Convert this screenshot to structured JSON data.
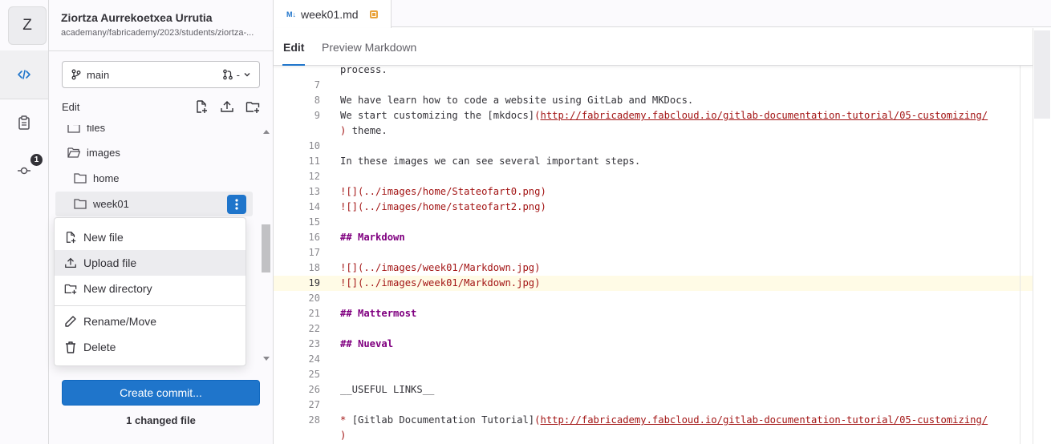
{
  "project": {
    "avatar_letter": "Z",
    "name": "Ziortza Aurrekoetxea Urrutia",
    "path": "academany/fabricademy/2023/students/ziortza-..."
  },
  "activity_bar": {
    "changes_badge": "1"
  },
  "branch": {
    "name": "main",
    "mr_label": "-"
  },
  "sidebar": {
    "edit_label": "Edit",
    "tree": [
      {
        "label": "files",
        "type": "folder"
      },
      {
        "label": "images",
        "type": "folder"
      },
      {
        "label": "home",
        "type": "folder"
      },
      {
        "label": "week01",
        "type": "folder",
        "selected": true
      }
    ],
    "context_menu": {
      "items": [
        "New file",
        "Upload file",
        "New directory",
        "Rename/Move",
        "Delete"
      ],
      "hovered": "Upload file"
    },
    "commit_button": "Create commit...",
    "changed_files": "1 changed file"
  },
  "editor": {
    "file_tab": "week01.md",
    "file_tab_icon": "M↓",
    "modes": {
      "edit": "Edit",
      "preview": "Preview Markdown"
    },
    "current_line": 19,
    "lines": [
      {
        "n": "",
        "segs": [
          {
            "t": "process."
          }
        ]
      },
      {
        "n": "7",
        "segs": []
      },
      {
        "n": "8",
        "segs": [
          {
            "t": "We have learn how to code a website using GitLab and MKDocs."
          }
        ]
      },
      {
        "n": "9",
        "segs": [
          {
            "t": "We start customizing the [mkdocs]"
          },
          {
            "t": "(",
            "c": "red"
          },
          {
            "t": "http://fabricademy.fabcloud.io/gitlab-documentation-tutorial/05-customizing/",
            "c": "url"
          }
        ]
      },
      {
        "n": "",
        "segs": [
          {
            "t": ")",
            "c": "red"
          },
          {
            "t": " theme."
          }
        ]
      },
      {
        "n": "10",
        "segs": []
      },
      {
        "n": "11",
        "segs": [
          {
            "t": "In these images we can see several important steps."
          }
        ]
      },
      {
        "n": "12",
        "segs": []
      },
      {
        "n": "13",
        "segs": [
          {
            "t": "![](../images/home/Stateofart0.png)",
            "c": "red"
          }
        ]
      },
      {
        "n": "14",
        "segs": [
          {
            "t": "![](../images/home/stateofart2.png)",
            "c": "red"
          }
        ]
      },
      {
        "n": "15",
        "segs": []
      },
      {
        "n": "16",
        "segs": [
          {
            "t": "## Markdown",
            "c": "hdr"
          }
        ]
      },
      {
        "n": "17",
        "segs": []
      },
      {
        "n": "18",
        "segs": [
          {
            "t": "![](../images/week01/Markdown.jpg)",
            "c": "red"
          }
        ]
      },
      {
        "n": "19",
        "segs": [
          {
            "t": "![](../images/week01/Markdown.jpg)",
            "c": "red"
          }
        ]
      },
      {
        "n": "20",
        "segs": []
      },
      {
        "n": "21",
        "segs": [
          {
            "t": "## Mattermost",
            "c": "hdr"
          }
        ]
      },
      {
        "n": "22",
        "segs": []
      },
      {
        "n": "23",
        "segs": [
          {
            "t": "## Nueval",
            "c": "hdr"
          }
        ]
      },
      {
        "n": "24",
        "segs": []
      },
      {
        "n": "25",
        "segs": []
      },
      {
        "n": "26",
        "segs": [
          {
            "t": "__USEFUL LINKS__"
          }
        ]
      },
      {
        "n": "27",
        "segs": []
      },
      {
        "n": "28",
        "segs": [
          {
            "t": "* ",
            "c": "red"
          },
          {
            "t": "[Gitlab Documentation Tutorial]"
          },
          {
            "t": "(",
            "c": "red"
          },
          {
            "t": "http://fabricademy.fabcloud.io/gitlab-documentation-tutorial/05-customizing/",
            "c": "url"
          }
        ]
      },
      {
        "n": "",
        "segs": [
          {
            "t": ")",
            "c": "red"
          }
        ]
      }
    ]
  },
  "colors": {
    "primary": "#1f75cb",
    "code_string": "#a31515",
    "code_heading": "#800080",
    "dirty_indicator": "#e9a33b"
  }
}
